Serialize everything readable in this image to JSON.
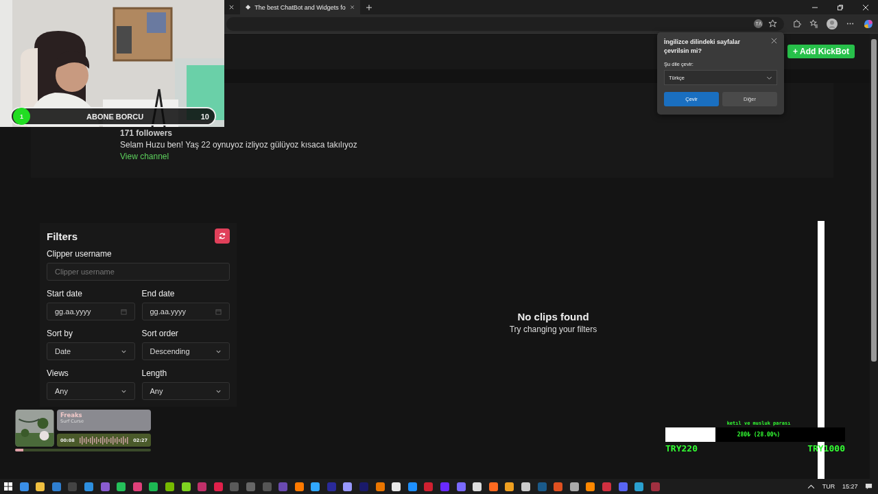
{
  "browser": {
    "tabs": [
      {
        "title": "The best ChatBot and Widgets fo",
        "selected": true
      }
    ]
  },
  "header": {
    "add_button": "+ Add KickBot"
  },
  "profile": {
    "followers": "171 followers",
    "bio": "Selam Huzu ben! Yaş 22 oynuyoz izliyoz gülüyoz kısaca takılıyoz",
    "link": "View channel"
  },
  "filters": {
    "title": "Filters",
    "fields": [
      {
        "kind": "text",
        "label": "Clipper username",
        "placeholder": "Clipper username"
      },
      {
        "kind": "date",
        "label": "Start date",
        "value": "gg.aa.yyyy"
      },
      {
        "kind": "date",
        "label": "End date",
        "value": "gg.aa.yyyy"
      },
      {
        "kind": "select",
        "label": "Sort by",
        "value": "Date"
      },
      {
        "kind": "select",
        "label": "Sort order",
        "value": "Descending"
      },
      {
        "kind": "select",
        "label": "Views",
        "value": "Any"
      },
      {
        "kind": "select",
        "label": "Length",
        "value": "Any"
      }
    ]
  },
  "empty_state": {
    "title": "No clips found",
    "hint": "Try changing your filters"
  },
  "translate_popup": {
    "title": "İngilizce dilindeki sayfalar çevrilsin mi?",
    "label": "Şu dile çevir:",
    "language": "Türkçe",
    "buttons": [
      {
        "label": "Çevir",
        "primary": true
      },
      {
        "label": "Diğer",
        "primary": false
      }
    ]
  },
  "subscriber_goal": {
    "badge": "1",
    "title": "ABONE BORCU",
    "count": "10"
  },
  "music_player": {
    "title": "Freaks",
    "artist": "Surf Curse",
    "elapsed": "00:08",
    "duration": "02:27",
    "level": 0.06
  },
  "donation_goal": {
    "title": "ketıl ve musluk parası",
    "level": 0.28,
    "progress": "280₺ (28.00%)",
    "start": "TRY220",
    "target": "TRY1000"
  },
  "taskbar": {
    "language": "TUR",
    "time": "15:27"
  }
}
